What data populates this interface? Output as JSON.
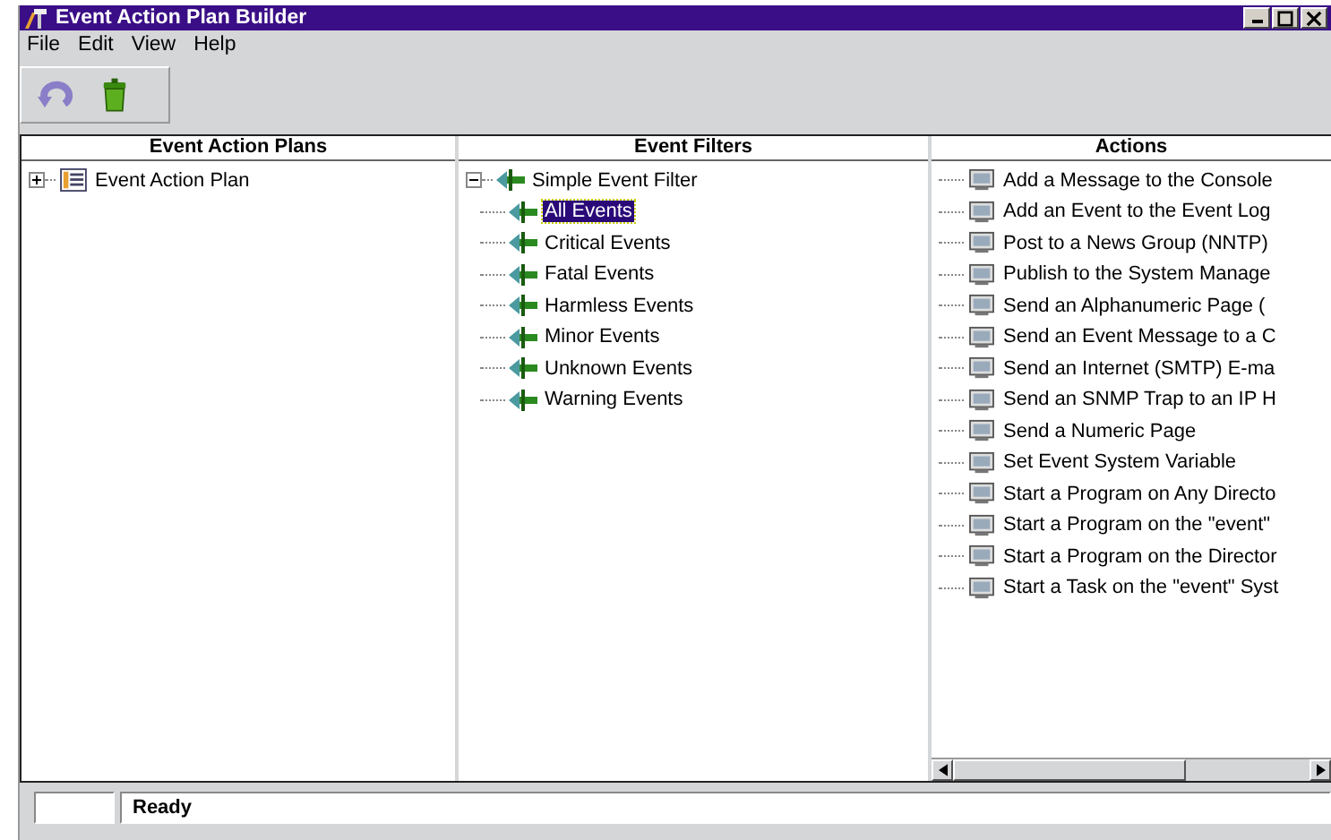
{
  "window": {
    "title": "Event Action Plan Builder"
  },
  "menu": [
    "File",
    "Edit",
    "View",
    "Help"
  ],
  "panels": [
    {
      "title": "Event Action Plans",
      "tree": [
        {
          "label": "Event Action Plan",
          "kind": "plan",
          "expanded": false,
          "selected": false
        }
      ]
    },
    {
      "title": "Event Filters",
      "tree": [
        {
          "label": "Simple Event Filter",
          "kind": "filter",
          "expanded": true,
          "selected": false,
          "children": [
            {
              "label": "All Events",
              "kind": "filter",
              "selected": true
            },
            {
              "label": "Critical Events",
              "kind": "filter",
              "selected": false
            },
            {
              "label": "Fatal Events",
              "kind": "filter",
              "selected": false
            },
            {
              "label": "Harmless Events",
              "kind": "filter",
              "selected": false
            },
            {
              "label": "Minor Events",
              "kind": "filter",
              "selected": false
            },
            {
              "label": "Unknown Events",
              "kind": "filter",
              "selected": false
            },
            {
              "label": "Warning Events",
              "kind": "filter",
              "selected": false
            }
          ]
        }
      ]
    },
    {
      "title": "Actions",
      "list": [
        {
          "label": "Add a Message to the Console",
          "selected": false
        },
        {
          "label": "Add an Event to the Event Log",
          "selected": false
        },
        {
          "label": "Post to a News Group (NNTP)",
          "selected": false
        },
        {
          "label": "Publish to the System Manage",
          "selected": false
        },
        {
          "label": "Send an Alphanumeric Page (",
          "selected": false
        },
        {
          "label": "Send an Event Message to a C",
          "selected": false
        },
        {
          "label": "Send an Internet (SMTP) E-ma",
          "selected": false
        },
        {
          "label": "Send an SNMP Trap to an IP H",
          "selected": false
        },
        {
          "label": "Send a Numeric Page",
          "selected": false
        },
        {
          "label": "Set Event System Variable",
          "selected": false
        },
        {
          "label": "Start a Program on Any Directo",
          "selected": false
        },
        {
          "label": "Start a Program on the \"event\"",
          "selected": false
        },
        {
          "label": "Start a Program on the Director",
          "selected": false
        },
        {
          "label": "Start a Task on the \"event\" Syst",
          "selected": false
        }
      ]
    }
  ],
  "status_bar": {
    "text": "Ready"
  }
}
